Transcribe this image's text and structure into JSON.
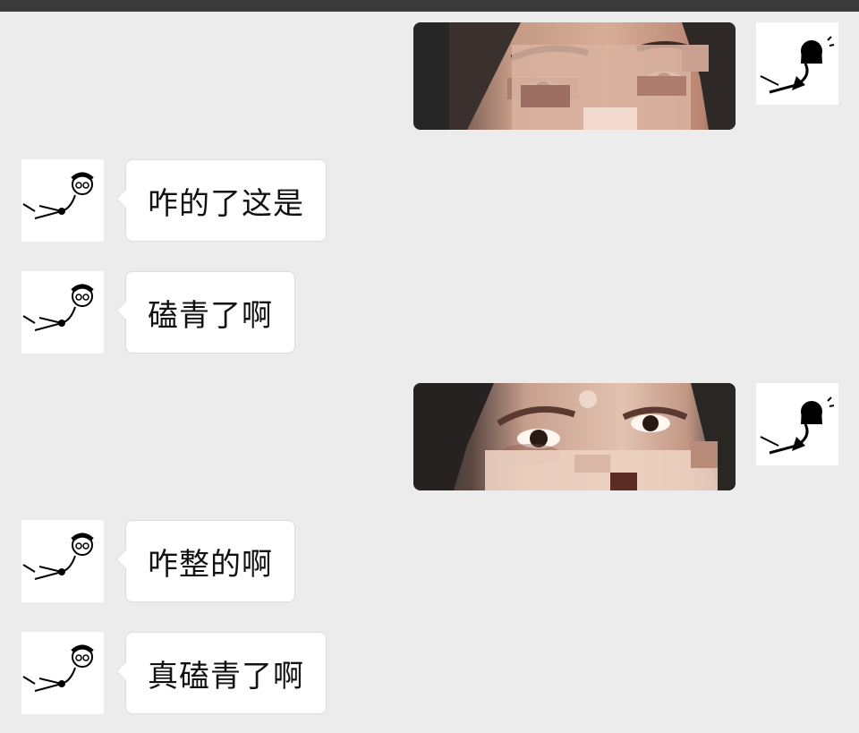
{
  "messages": [
    {
      "id": "m1",
      "sender": "self",
      "type": "image",
      "image_desc": "face-photo-1"
    },
    {
      "id": "m2",
      "sender": "friend",
      "type": "text",
      "text": "咋的了这是"
    },
    {
      "id": "m3",
      "sender": "friend",
      "type": "text",
      "text": "磕青了啊"
    },
    {
      "id": "m4",
      "sender": "self",
      "type": "image",
      "image_desc": "face-photo-2"
    },
    {
      "id": "m5",
      "sender": "friend",
      "type": "text",
      "text": "咋整的啊"
    },
    {
      "id": "m6",
      "sender": "friend",
      "type": "text",
      "text": "真磕青了啊"
    }
  ],
  "colors": {
    "background": "#ececec",
    "topbar": "#3a3a3a",
    "bubble_friend": "#ffffff",
    "bubble_border": "#dcdcdc"
  }
}
